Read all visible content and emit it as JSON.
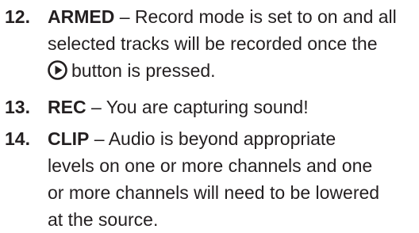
{
  "items": [
    {
      "number": "12.",
      "term": "ARMED",
      "lines": [
        " – Record mode is set to on and all",
        "selected tracks will be recorded once the",
        "button is pressed."
      ],
      "icon": "play-button-icon"
    },
    {
      "number": "13.",
      "term": "REC",
      "lines": [
        " – You are capturing sound!"
      ]
    },
    {
      "number": "14.",
      "term": "CLIP",
      "lines": [
        " – Audio is beyond appropriate",
        "levels on one or more channels and one",
        "or more channels will need to be lowered",
        "at the source."
      ]
    }
  ]
}
